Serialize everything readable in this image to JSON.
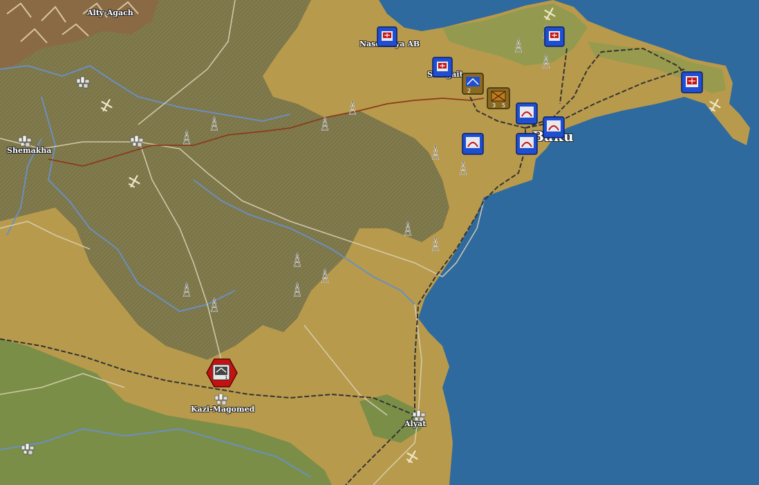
{
  "map": {
    "title": "",
    "colors": {
      "sea": "#2f6a9e",
      "plain": "#b89a4c",
      "highland": "#807a4c",
      "lowland": "#7b8e48",
      "river": "#6b8fbf",
      "road": "#d9d0b4",
      "rail": "#3a3a3a",
      "pipeline": "#8b3a1a",
      "soviet_unit": "#1f4fd1",
      "axis_unit": "#c41212",
      "supply_unit": "#8a6a22"
    },
    "places": [
      {
        "id": "alty-agach",
        "name": "Alty-Agach"
      },
      {
        "id": "nasosnaya",
        "name": "Nasosnaya AB"
      },
      {
        "id": "sumgait",
        "name": "Sumgait"
      },
      {
        "id": "shemakha",
        "name": "Shemakha"
      },
      {
        "id": "baku",
        "name": "Baku"
      },
      {
        "id": "kazi-magomed",
        "name": "Kazi-Magomed"
      },
      {
        "id": "alyat",
        "name": "Alyat"
      }
    ],
    "units": [
      {
        "id": "nasosnaya-air",
        "side": "soviet",
        "type": "airfield"
      },
      {
        "id": "sumgait-air",
        "side": "soviet",
        "type": "airfield"
      },
      {
        "id": "apsheron-air",
        "side": "soviet",
        "type": "airfield"
      },
      {
        "id": "east-air",
        "side": "soviet",
        "type": "airfield"
      },
      {
        "id": "rail-hq",
        "side": "soviet",
        "type": "hq",
        "strength": "2"
      },
      {
        "id": "supply-depot",
        "side": "soviet",
        "type": "supply",
        "strength": "3",
        "value": "5"
      },
      {
        "id": "baku-flak-1",
        "side": "soviet",
        "type": "flak"
      },
      {
        "id": "baku-flak-2",
        "side": "soviet",
        "type": "flak"
      },
      {
        "id": "baku-flak-3",
        "side": "soviet",
        "type": "flak"
      },
      {
        "id": "west-flak",
        "side": "soviet",
        "type": "flak"
      },
      {
        "id": "axis-recon",
        "side": "axis",
        "type": "recon",
        "strength": "1"
      }
    ]
  }
}
